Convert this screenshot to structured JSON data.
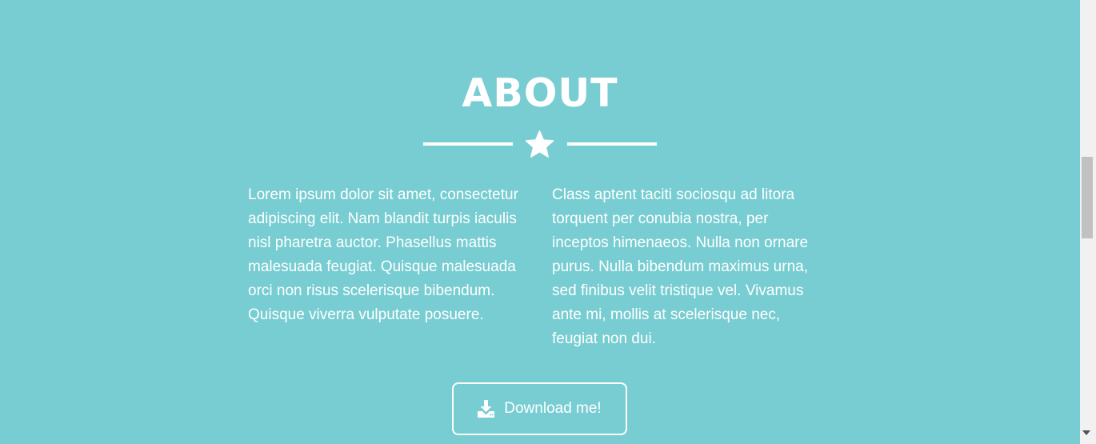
{
  "about": {
    "title": "ABOUT",
    "divider_icon": "star-icon",
    "paragraphs": {
      "left": "Lorem ipsum dolor sit amet, consectetur adipiscing elit. Nam blandit turpis iaculis nisl pharetra auctor. Phasellus mattis malesuada feugiat. Quisque malesuada orci non risus scelerisque bibendum. Quisque viverra vulputate posuere.",
      "right": "Class aptent taciti sociosqu ad litora torquent per conubia nostra, per inceptos himenaeos. Nulla non ornare purus. Nulla bibendum maximus urna, sed finibus velit tristique vel. Vivamus ante mi, mollis at scelerisque nec, feugiat non dui."
    },
    "download_button": {
      "label": "Download me!",
      "icon": "download-icon"
    }
  },
  "colors": {
    "background": "#78cdd2",
    "text": "#ffffff",
    "top_accent": "#9c2a5b"
  }
}
